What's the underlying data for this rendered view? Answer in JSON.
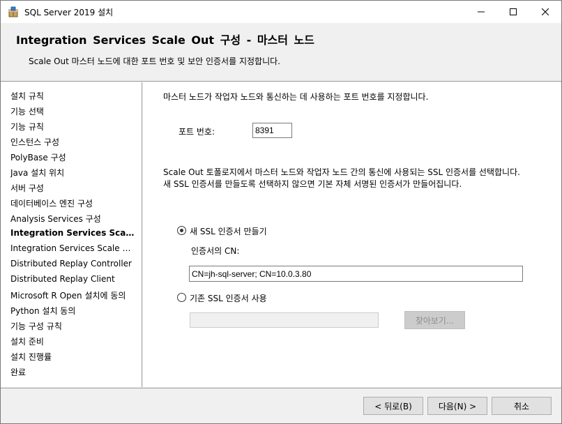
{
  "window": {
    "title": "SQL Server 2019 설치",
    "icon": "sql-setup-box-icon"
  },
  "header": {
    "title": "Integration Services Scale Out 구성 - 마스터 노드",
    "subtitle": "Scale Out 마스터 노드에 대한 포트 번호 및 보안 인증서를 지정합니다."
  },
  "nav": {
    "items": [
      {
        "label": "설치 규칙"
      },
      {
        "label": "기능 선택"
      },
      {
        "label": "기능 규칙"
      },
      {
        "label": "인스턴스 구성"
      },
      {
        "label": "PolyBase 구성"
      },
      {
        "label": "Java 설치 위치"
      },
      {
        "label": "서버 구성"
      },
      {
        "label": "데이터베이스 엔진 구성"
      },
      {
        "label": "Analysis Services 구성"
      },
      {
        "label": "Integration Services Scale O..."
      },
      {
        "label": "Integration Services Scale Out ..."
      },
      {
        "label": "Distributed Replay Controller"
      },
      {
        "label": "Distributed Replay Client"
      },
      {
        "label": "Microsoft R Open 설치에 동의"
      },
      {
        "label": "Python 설치 동의"
      },
      {
        "label": "기능 구성 규칙"
      },
      {
        "label": "설치 준비"
      },
      {
        "label": "설치 진행률"
      },
      {
        "label": "완료"
      }
    ],
    "active_index": 9
  },
  "content": {
    "port_description": "마스터 노드가 작업자 노드와 통신하는 데 사용하는 포트 번호를 지정합니다.",
    "port_label": "포트 번호:",
    "port_value": "8391",
    "ssl_description_line1": "Scale Out 토폴로지에서 마스터 노드와 작업자 노드 간의 통신에 사용되는 SSL 인증서를 선택합니다.",
    "ssl_description_line2": "새 SSL 인증서를 만들도록 선택하지 않으면 기본 자체 서명된 인증서가 만들어집니다.",
    "new_cert_option": {
      "label": "새 SSL 인증서 만들기",
      "checked": true
    },
    "cn_label": "인증서의 CN:",
    "cn_value": "CN=jh-sql-server; CN=10.0.3.80",
    "existing_cert_option": {
      "label": "기존 SSL 인증서 사용",
      "checked": false
    },
    "existing_cert_value": "",
    "browse_label": "찾아보기..."
  },
  "footer": {
    "back_label": "< 뒤로(B)",
    "next_label": "다음(N) >",
    "cancel_label": "취소"
  }
}
